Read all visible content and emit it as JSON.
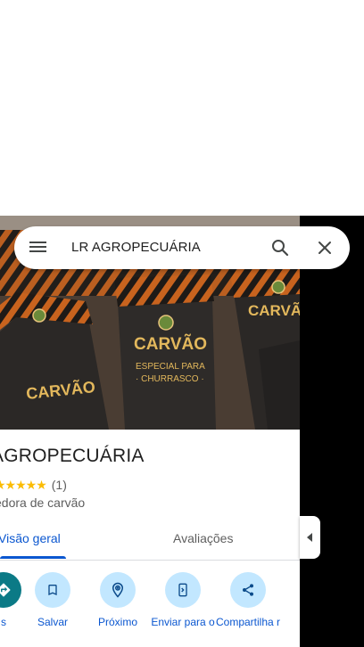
{
  "search": {
    "query": "LR AGROPECUÁRIA"
  },
  "place": {
    "title": "AGROPECUÁRIA",
    "stars": "★★★★★",
    "review_count": "(1)",
    "category": "edora de carvão"
  },
  "photo": {
    "bag_brand": "CARVÃO",
    "bag_subtitle_1": "ESPECIAL PARA",
    "bag_subtitle_2": "· CHURRASCO ·"
  },
  "tabs": [
    {
      "label": "Visão geral",
      "active": true
    },
    {
      "label": "Avaliações",
      "active": false
    }
  ],
  "actions": [
    {
      "label": "s",
      "icon": "directions-icon"
    },
    {
      "label": "Salvar",
      "icon": "bookmark-icon"
    },
    {
      "label": "Próximo",
      "icon": "nearby-icon"
    },
    {
      "label": "Enviar para o",
      "icon": "send-to-phone-icon"
    },
    {
      "label": "Compartilha r",
      "icon": "share-icon"
    }
  ],
  "colors": {
    "accent": "#0b57d0",
    "action_bg": "#c2e7ff",
    "star": "#fbbc04",
    "bag": "#2b2b2b",
    "stripe": "#d2691e"
  }
}
